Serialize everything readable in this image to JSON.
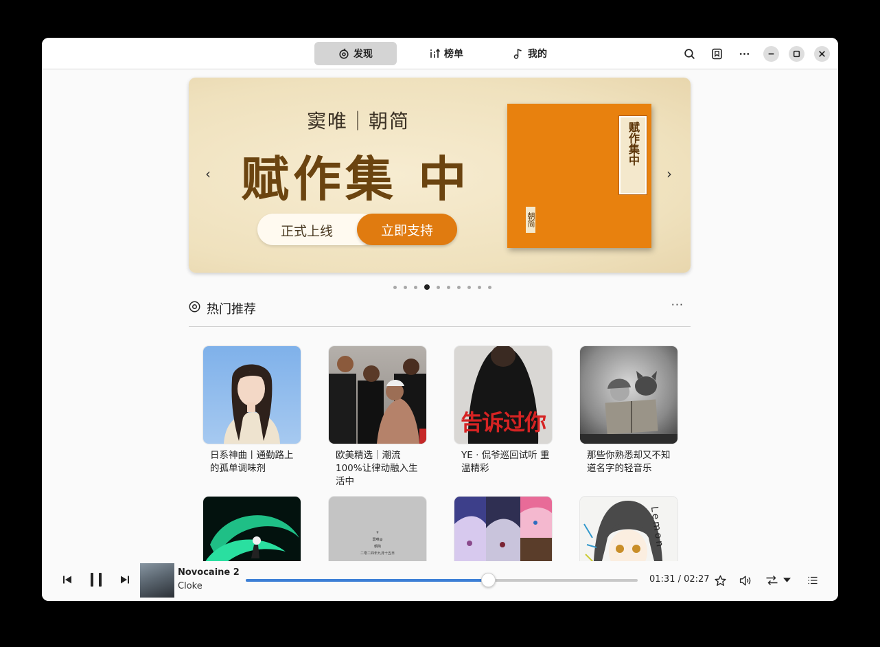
{
  "header": {
    "tabs": [
      {
        "label": "发现",
        "icon": "discover-icon",
        "active": true
      },
      {
        "label": "榜单",
        "icon": "chart-icon",
        "active": false
      },
      {
        "label": "我的",
        "icon": "music-note-icon",
        "active": false
      }
    ],
    "actions": [
      "search-icon",
      "bookmark-icon",
      "more-icon"
    ],
    "window_controls": [
      "minimize-icon",
      "maximize-icon",
      "close-icon"
    ]
  },
  "banner": {
    "subtitle": "窦唯｜朝简",
    "title": "赋作集 中",
    "pill_left": "正式上线",
    "pill_right": "立即支持",
    "book_label": "赋作集中",
    "book_small_label": "朝简",
    "slide_count": 10,
    "active_slide": 4
  },
  "section": {
    "title": "热门推荐",
    "more": "···"
  },
  "playlists": [
    {
      "title": "日系神曲丨通勤路上的孤单调味剂"
    },
    {
      "title": "欧美精选｜潮流100%让律动融入生活中"
    },
    {
      "title": "YE · 侃爷巡回试听 重温精彩",
      "cover_text": "告诉过你"
    },
    {
      "title": "那些你熟悉却又不知道名字的轻音乐"
    },
    {
      "title": ""
    },
    {
      "title": "",
      "cover_lines": [
        "¥",
        "窦唯@",
        "朝简",
        "二零二四年九月十五日"
      ]
    },
    {
      "title": ""
    },
    {
      "title": "",
      "cover_text": "Lemon"
    }
  ],
  "player": {
    "title": "Novocaine 2",
    "artist": "Cloke",
    "time": "01:31 / 02:27",
    "progress": 0.619,
    "controls": [
      "previous-icon",
      "pause-icon",
      "next-icon",
      "star-icon",
      "volume-icon",
      "repeat-icon",
      "dropdown-icon",
      "playlist-icon"
    ]
  }
}
